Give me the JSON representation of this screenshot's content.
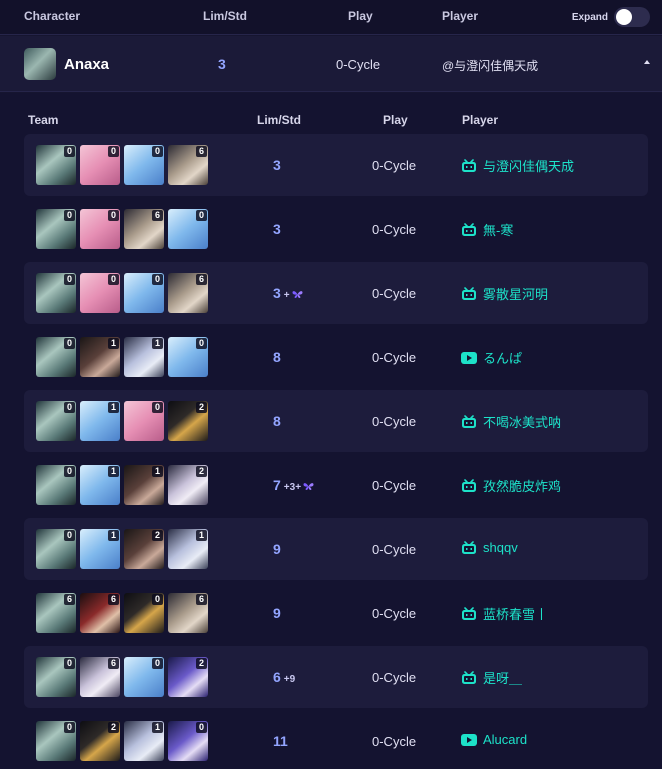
{
  "header": {
    "character": "Character",
    "lim_std": "Lim/Std",
    "play": "Play",
    "player": "Player",
    "expand_label": "Expand",
    "expand_on": false
  },
  "character_row": {
    "name": "Anaxa",
    "lim_std": "3",
    "play": "0-Cycle",
    "player": "@与澄闪佳偶天成"
  },
  "sub_header": {
    "team": "Team",
    "lim_std": "Lim/Std",
    "play": "Play",
    "player": "Player"
  },
  "rows": [
    {
      "team": [
        {
          "c": "anaxa",
          "e": "0"
        },
        {
          "c": "pink",
          "e": "0"
        },
        {
          "c": "blue",
          "e": "0"
        },
        {
          "c": "brown",
          "e": "6"
        }
      ],
      "lim": "3",
      "extra": "",
      "butterfly": false,
      "play": "0-Cycle",
      "platform": "bilibili",
      "player": "与澄闪佳偶天成"
    },
    {
      "team": [
        {
          "c": "anaxa",
          "e": "0"
        },
        {
          "c": "pink",
          "e": "0"
        },
        {
          "c": "brown",
          "e": "6"
        },
        {
          "c": "blue",
          "e": "0"
        }
      ],
      "lim": "3",
      "extra": "",
      "butterfly": false,
      "play": "0-Cycle",
      "platform": "bilibili",
      "player": "無-寒"
    },
    {
      "team": [
        {
          "c": "anaxa",
          "e": "0"
        },
        {
          "c": "pink",
          "e": "0"
        },
        {
          "c": "blue",
          "e": "0"
        },
        {
          "c": "brown",
          "e": "6"
        }
      ],
      "lim": "3",
      "extra": "+",
      "butterfly": true,
      "play": "0-Cycle",
      "platform": "bilibili",
      "player": "雾散星河明"
    },
    {
      "team": [
        {
          "c": "anaxa",
          "e": "0"
        },
        {
          "c": "dark",
          "e": "1"
        },
        {
          "c": "silver",
          "e": "1"
        },
        {
          "c": "blue",
          "e": "0"
        }
      ],
      "lim": "8",
      "extra": "",
      "butterfly": false,
      "play": "0-Cycle",
      "platform": "youtube",
      "player": "るんぱ"
    },
    {
      "team": [
        {
          "c": "anaxa",
          "e": "0"
        },
        {
          "c": "blue",
          "e": "1"
        },
        {
          "c": "pink",
          "e": "0"
        },
        {
          "c": "black",
          "e": "2"
        }
      ],
      "lim": "8",
      "extra": "",
      "butterfly": false,
      "play": "0-Cycle",
      "platform": "bilibili",
      "player": "不喝冰美式呐"
    },
    {
      "team": [
        {
          "c": "anaxa",
          "e": "0"
        },
        {
          "c": "blue",
          "e": "1"
        },
        {
          "c": "dark",
          "e": "1"
        },
        {
          "c": "white",
          "e": "2"
        }
      ],
      "lim": "7",
      "extra": "+3+",
      "butterfly": true,
      "play": "0-Cycle",
      "platform": "bilibili",
      "player": "孜然脆皮炸鸡"
    },
    {
      "team": [
        {
          "c": "anaxa",
          "e": "0"
        },
        {
          "c": "blue",
          "e": "1"
        },
        {
          "c": "dark",
          "e": "2"
        },
        {
          "c": "silver",
          "e": "1"
        }
      ],
      "lim": "9",
      "extra": "",
      "butterfly": false,
      "play": "0-Cycle",
      "platform": "bilibili",
      "player": "shqqv"
    },
    {
      "team": [
        {
          "c": "anaxa",
          "e": "6"
        },
        {
          "c": "red",
          "e": "6"
        },
        {
          "c": "black",
          "e": "0"
        },
        {
          "c": "brown",
          "e": "6"
        }
      ],
      "lim": "9",
      "extra": "",
      "butterfly": false,
      "play": "0-Cycle",
      "platform": "bilibili",
      "player": "蓝桥春雪丨"
    },
    {
      "team": [
        {
          "c": "anaxa",
          "e": "0"
        },
        {
          "c": "white",
          "e": "6"
        },
        {
          "c": "blue",
          "e": "0"
        },
        {
          "c": "purple",
          "e": "2"
        }
      ],
      "lim": "6",
      "extra": "+9",
      "butterfly": false,
      "play": "0-Cycle",
      "platform": "bilibili",
      "player": "是呀＿"
    },
    {
      "team": [
        {
          "c": "anaxa",
          "e": "0"
        },
        {
          "c": "black",
          "e": "2"
        },
        {
          "c": "silver",
          "e": "1"
        },
        {
          "c": "purple",
          "e": "0"
        }
      ],
      "lim": "11",
      "extra": "",
      "butterfly": false,
      "play": "0-Cycle",
      "platform": "youtube",
      "player": "Alucard"
    }
  ],
  "colors": {
    "accent": "#93a5ff",
    "player_link": "#1de2c9",
    "background": "#141330"
  }
}
